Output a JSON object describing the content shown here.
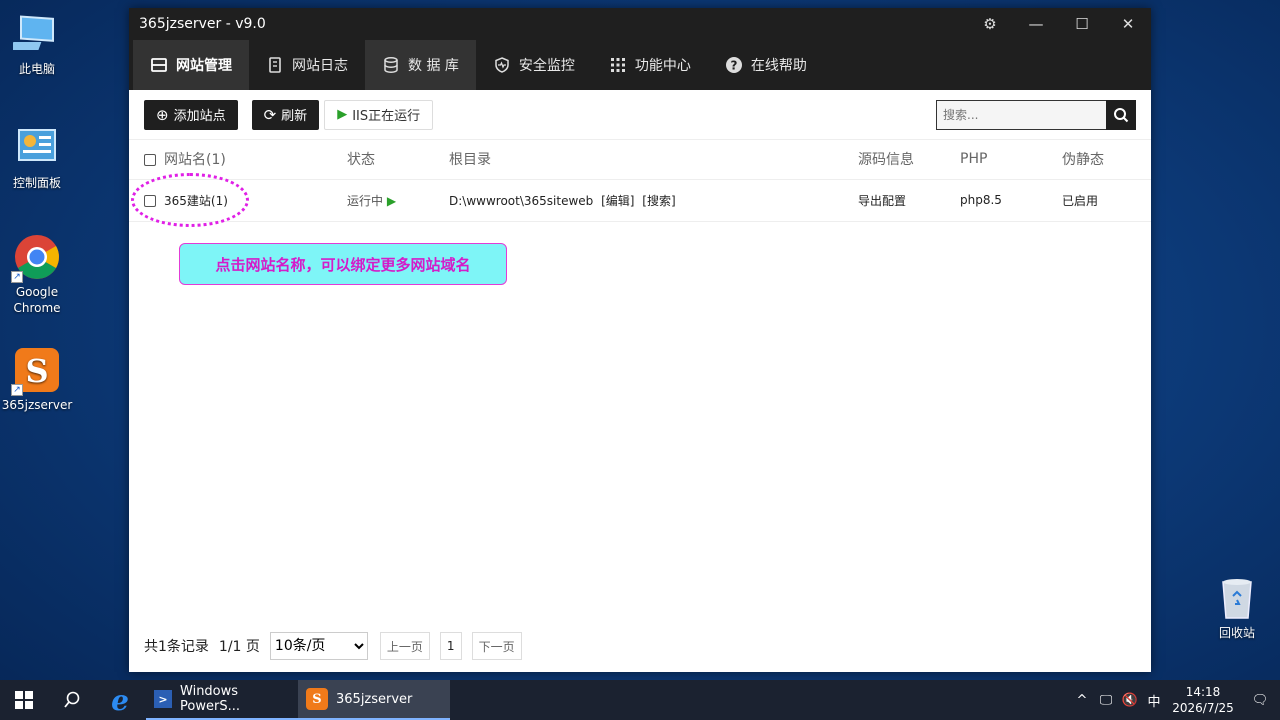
{
  "desktop": {
    "icons": [
      {
        "label": "此电脑"
      },
      {
        "label": "控制面板"
      },
      {
        "label": "Google Chrome"
      },
      {
        "label": "365jzserver"
      },
      {
        "label": "回收站"
      }
    ]
  },
  "window": {
    "title": "365jzserver - v9.0",
    "nav": [
      {
        "label": "网站管理"
      },
      {
        "label": "网站日志"
      },
      {
        "label": "数 据 库"
      },
      {
        "label": "安全监控"
      },
      {
        "label": "功能中心"
      },
      {
        "label": "在线帮助"
      }
    ],
    "toolbar": {
      "add_label": "添加站点",
      "refresh_label": "刷新",
      "iis_label": "IIS正在运行",
      "search_placeholder": "搜索..."
    },
    "table": {
      "headers": [
        "网站名(1)",
        "状态",
        "根目录",
        "源码信息",
        "PHP",
        "伪静态"
      ],
      "rows": [
        {
          "name": "365建站(1)",
          "status": "运行中",
          "root": "D:\\wwwroot\\365siteweb",
          "edit": "[编辑]",
          "search": "[搜索]",
          "source": "导出配置",
          "php": "php8.5",
          "rewrite": "已启用"
        }
      ]
    },
    "tip": "点击网站名称，可以绑定更多网站域名",
    "pager": {
      "total": "共1条记录",
      "pages": "1/1 页",
      "per_page": "10条/页",
      "prev": "上一页",
      "current": "1",
      "next": "下一页"
    }
  },
  "taskbar": {
    "tasks": [
      {
        "label": "Windows PowerS..."
      },
      {
        "label": "365jzserver"
      }
    ],
    "ime": "中",
    "time": "14:18",
    "date": "2026/7/25"
  },
  "colors": {
    "accent_dark": "#1f1f1f",
    "tip_bg": "#7ef5f7",
    "tip_text": "#d41cc9",
    "run_green": "#2aa02a"
  }
}
